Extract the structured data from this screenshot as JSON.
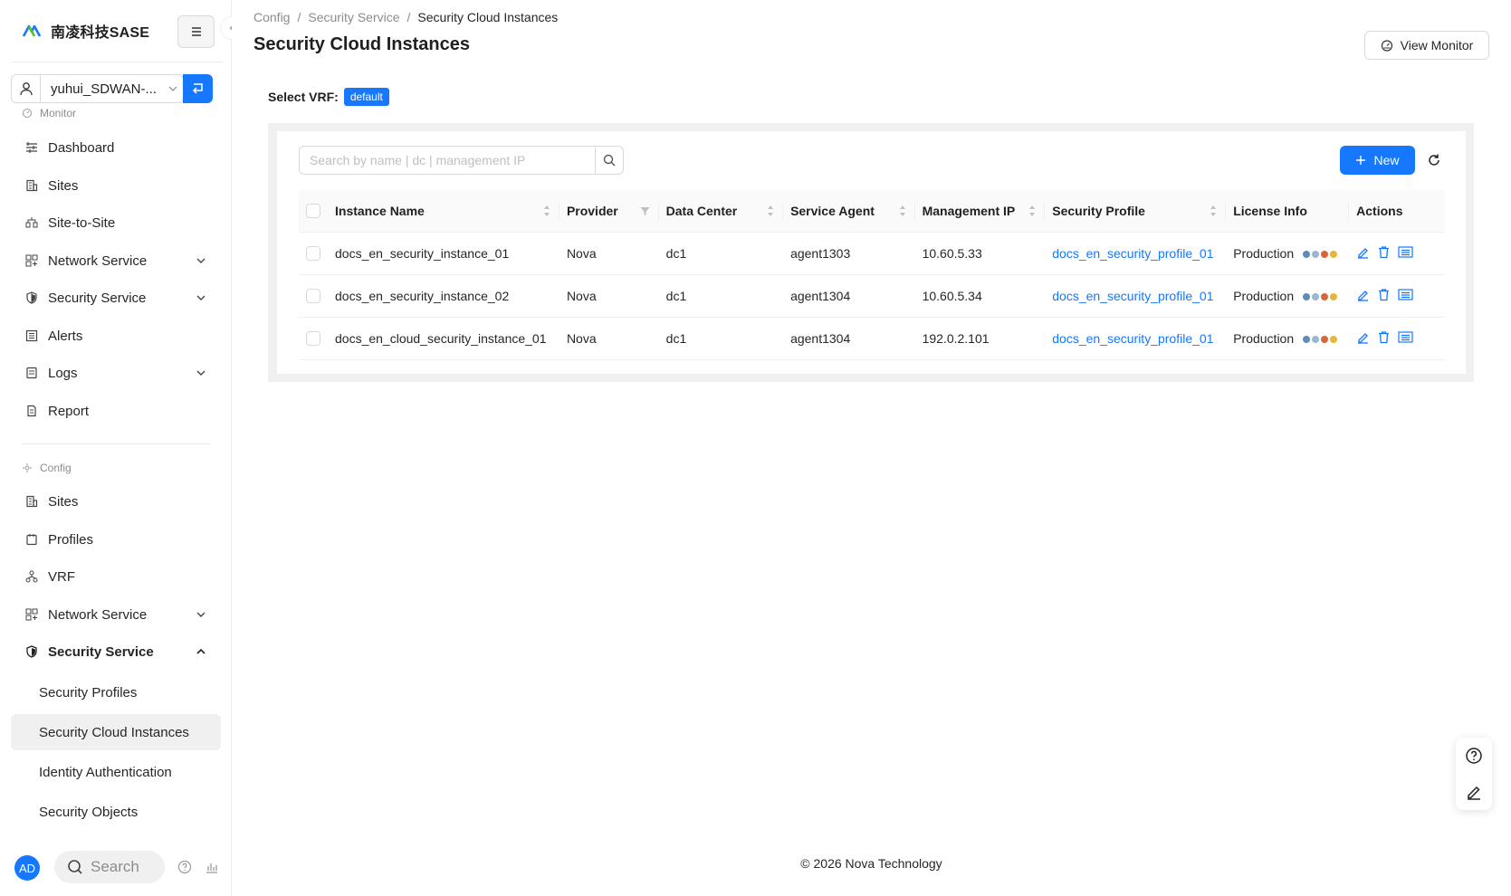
{
  "brand": {
    "name": "南凌科技SASE"
  },
  "tenant": {
    "name": "yuhui_SDWAN-..."
  },
  "sidebar": {
    "monitor_label": "Monitor",
    "monitor_items": [
      {
        "label": "Dashboard"
      },
      {
        "label": "Sites"
      },
      {
        "label": "Site-to-Site"
      },
      {
        "label": "Network Service"
      },
      {
        "label": "Security Service"
      },
      {
        "label": "Alerts"
      },
      {
        "label": "Logs"
      },
      {
        "label": "Report"
      }
    ],
    "config_label": "Config",
    "config_items": [
      {
        "label": "Sites"
      },
      {
        "label": "Profiles"
      },
      {
        "label": "VRF"
      },
      {
        "label": "Network Service"
      },
      {
        "label": "Security Service"
      }
    ],
    "security_sub": [
      {
        "label": "Security Profiles"
      },
      {
        "label": "Security Cloud Instances"
      },
      {
        "label": "Identity Authentication"
      },
      {
        "label": "Security Objects"
      }
    ],
    "avatar": "AD",
    "search_label": "Search"
  },
  "breadcrumb": {
    "items": [
      "Config",
      "Security Service",
      "Security Cloud Instances"
    ],
    "separator": "/"
  },
  "page": {
    "title": "Security Cloud Instances",
    "view_monitor": "View Monitor",
    "vrf_label": "Select VRF:",
    "vrf_value": "default"
  },
  "toolbar": {
    "search_placeholder": "Search by name | dc | management IP",
    "new_label": "New"
  },
  "table": {
    "columns": [
      "Instance Name",
      "Provider",
      "Data Center",
      "Service Agent",
      "Management IP",
      "Security Profile",
      "License Info",
      "Actions"
    ],
    "rows": [
      {
        "name": "docs_en_security_instance_01",
        "provider": "Nova",
        "dc": "dc1",
        "agent": "agent1303",
        "ip": "10.60.5.33",
        "profile": "docs_en_security_profile_01",
        "license": "Production"
      },
      {
        "name": "docs_en_security_instance_02",
        "provider": "Nova",
        "dc": "dc1",
        "agent": "agent1304",
        "ip": "10.60.5.34",
        "profile": "docs_en_security_profile_01",
        "license": "Production"
      },
      {
        "name": "docs_en_cloud_security_instance_01",
        "provider": "Nova",
        "dc": "dc1",
        "agent": "agent1304",
        "ip": "192.0.2.101",
        "profile": "docs_en_security_profile_01",
        "license": "Production"
      }
    ]
  },
  "footer": {
    "text": "© 2026 Nova Technology"
  },
  "colors": {
    "accent": "#1677ff",
    "panel_bg": "#f0f0f0",
    "header_bg": "#fafafa"
  }
}
